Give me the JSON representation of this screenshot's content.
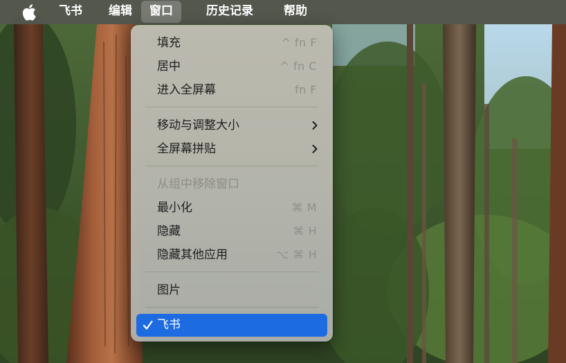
{
  "menubar": {
    "apple_icon": "apple-logo-icon",
    "items": [
      "飞书",
      "编辑",
      "窗口",
      "历史记录",
      "帮助"
    ],
    "active_item": "窗口"
  },
  "window_menu": {
    "items": [
      {
        "label": "填充",
        "shortcut": "^ fn F",
        "enabled": true
      },
      {
        "label": "居中",
        "shortcut": "^ fn C",
        "enabled": true
      },
      {
        "label": "进入全屏幕",
        "shortcut": "fn F",
        "enabled": true
      },
      {
        "label": "移动与调整大小",
        "submenu": true,
        "enabled": true
      },
      {
        "label": "全屏幕拼贴",
        "submenu": true,
        "enabled": true
      },
      {
        "label": "从组中移除窗口",
        "enabled": false
      },
      {
        "label": "最小化",
        "shortcut": "⌘ M",
        "enabled": true
      },
      {
        "label": "隐藏",
        "shortcut": "⌘ H",
        "enabled": true
      },
      {
        "label": "隐藏其他应用",
        "shortcut": "⌥ ⌘ H",
        "enabled": true
      },
      {
        "label": "图片",
        "enabled": true
      },
      {
        "label": "飞书",
        "checked": true,
        "selected": true,
        "check_icon": "checkmark-icon"
      }
    ]
  },
  "colors": {
    "menubar_bg": "#54564e",
    "selection_accent": "#1d6be0",
    "menu_text": "#1e1e1e",
    "shortcut_text": "#8f8f8a"
  }
}
